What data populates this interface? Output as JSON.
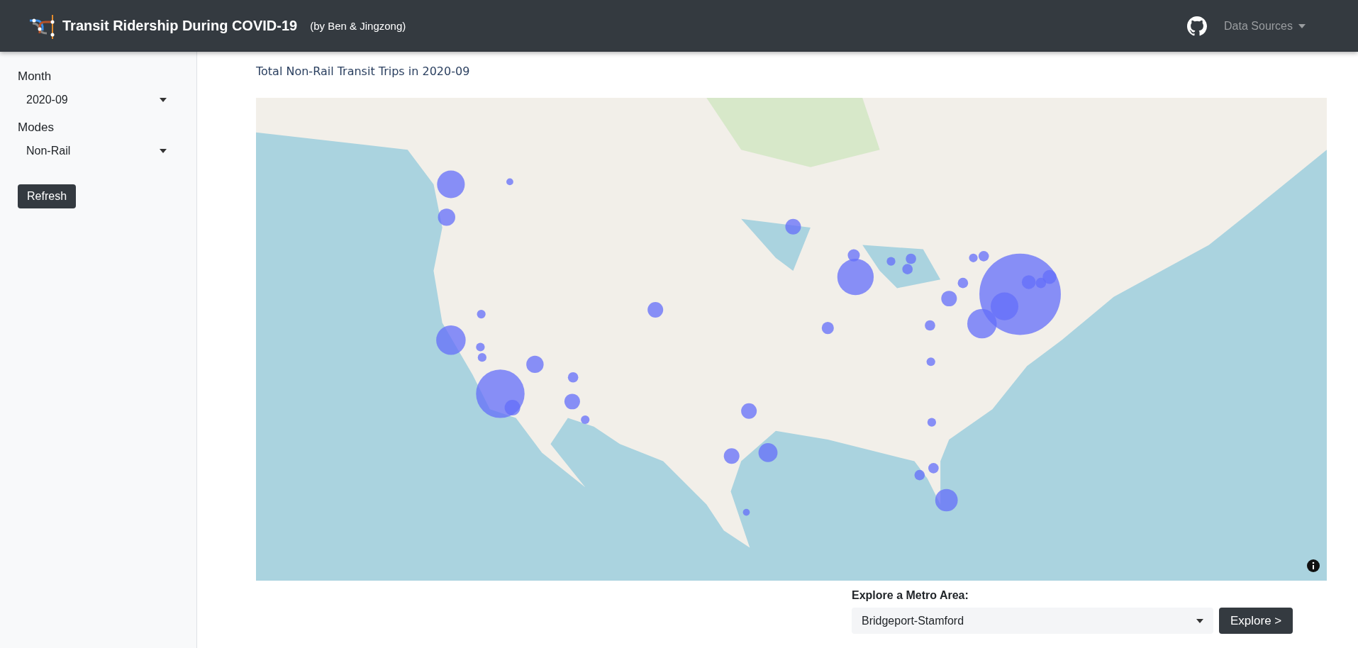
{
  "header": {
    "title": "Transit Ridership During COVID-19",
    "subtitle": "(by Ben & Jingzong)",
    "menu": "Data Sources"
  },
  "sidebar": {
    "filters": [
      {
        "label": "Month",
        "value": "2020-09"
      },
      {
        "label": "Modes",
        "value": "Non-Rail"
      }
    ],
    "button": "Refresh"
  },
  "map": {
    "title": "Total Non-Rail Transit Trips in 2020-09"
  },
  "explore": {
    "label": "Explore a Metro Area:",
    "value": "Bridgeport-Stamford",
    "button": "Explore >"
  }
}
